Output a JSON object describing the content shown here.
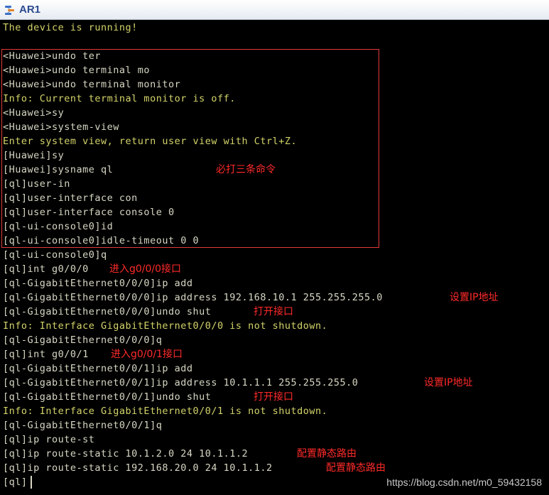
{
  "window": {
    "title": "AR1",
    "icon": "network-device-icon"
  },
  "terminal": {
    "lines": [
      {
        "text": "The device is running!",
        "style": "green"
      },
      {
        "text": "",
        "style": "normal"
      },
      {
        "text": "<Huawei>undo ter",
        "style": "normal"
      },
      {
        "text": "<Huawei>undo terminal mo",
        "style": "normal"
      },
      {
        "text": "<Huawei>undo terminal monitor",
        "style": "normal"
      },
      {
        "text": "Info: Current terminal monitor is off.",
        "style": "green"
      },
      {
        "text": "<Huawei>sy",
        "style": "normal"
      },
      {
        "text": "<Huawei>system-view",
        "style": "normal"
      },
      {
        "text": "Enter system view, return user view with Ctrl+Z.",
        "style": "green"
      },
      {
        "text": "[Huawei]sy",
        "style": "normal"
      },
      {
        "text": "[Huawei]sysname ql",
        "style": "normal"
      },
      {
        "text": "[ql]user-in",
        "style": "normal"
      },
      {
        "text": "[ql]user-interface con",
        "style": "normal"
      },
      {
        "text": "[ql]user-interface console 0",
        "style": "normal"
      },
      {
        "text": "[ql-ui-console0]id",
        "style": "normal"
      },
      {
        "text": "[ql-ui-console0]idle-timeout 0 0",
        "style": "normal"
      },
      {
        "text": "[ql-ui-console0]q",
        "style": "normal"
      },
      {
        "text": "[ql]int g0/0/0",
        "style": "normal"
      },
      {
        "text": "[ql-GigabitEthernet0/0/0]ip add",
        "style": "normal"
      },
      {
        "text": "[ql-GigabitEthernet0/0/0]ip address 192.168.10.1 255.255.255.0",
        "style": "normal"
      },
      {
        "text": "[ql-GigabitEthernet0/0/0]undo shut",
        "style": "normal"
      },
      {
        "text": "Info: Interface GigabitEthernet0/0/0 is not shutdown.",
        "style": "green"
      },
      {
        "text": "[ql-GigabitEthernet0/0/0]q",
        "style": "normal"
      },
      {
        "text": "[ql]int g0/0/1",
        "style": "normal"
      },
      {
        "text": "[ql-GigabitEthernet0/0/1]ip add",
        "style": "normal"
      },
      {
        "text": "[ql-GigabitEthernet0/0/1]ip address 10.1.1.1 255.255.255.0",
        "style": "normal"
      },
      {
        "text": "[ql-GigabitEthernet0/0/1]undo shut",
        "style": "normal"
      },
      {
        "text": "Info: Interface GigabitEthernet0/0/1 is not shutdown.",
        "style": "green"
      },
      {
        "text": "[ql-GigabitEthernet0/0/1]q",
        "style": "normal"
      },
      {
        "text": "[ql]ip route-st",
        "style": "normal"
      },
      {
        "text": "[ql]ip route-static 10.1.2.0 24 10.1.1.2",
        "style": "normal"
      },
      {
        "text": "[ql]ip route-static 192.168.20.0 24 10.1.1.2",
        "style": "normal"
      },
      {
        "text": "[ql]",
        "style": "normal"
      }
    ],
    "annotations": [
      {
        "line": 10,
        "text": "必打三条命令"
      },
      {
        "line": 17,
        "text": "进入g0/0/0接口"
      },
      {
        "line": 19,
        "text": "设置IP地址"
      },
      {
        "line": 20,
        "text": "打开接口"
      },
      {
        "line": 23,
        "text": "进入g0/0/1接口"
      },
      {
        "line": 25,
        "text": "设置IP地址"
      },
      {
        "line": 26,
        "text": "打开接口"
      },
      {
        "line": 30,
        "text": "配置静态路由"
      },
      {
        "line": 31,
        "text": "配置静态路由"
      }
    ]
  },
  "watermark": "https://blog.csdn.net/m0_59432158",
  "colors": {
    "background": "#000000",
    "text": "#d7d7c4",
    "info_text": "#d3d36a",
    "annotation": "#ff2a2a",
    "title": "#2b4a8f"
  }
}
